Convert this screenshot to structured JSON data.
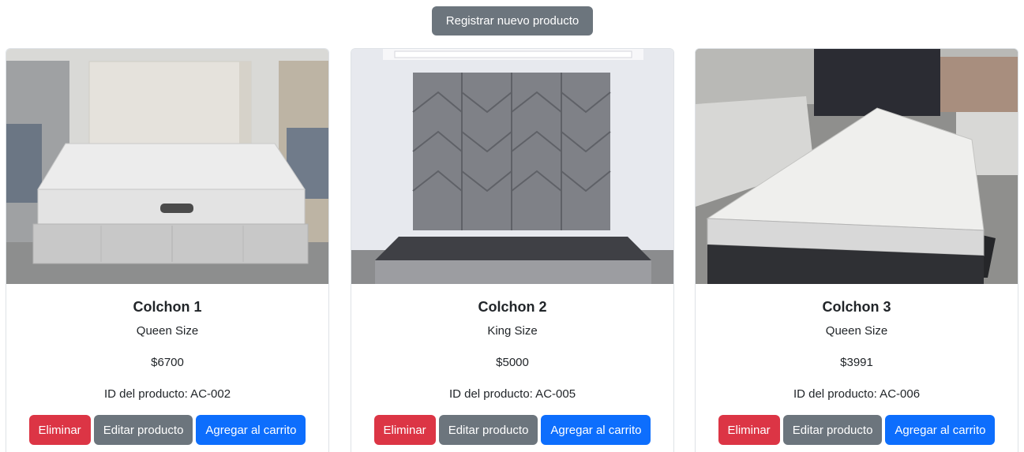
{
  "header": {
    "register_label": "Registrar nuevo producto"
  },
  "colors": {
    "danger": "#dc3545",
    "secondary": "#6c757d",
    "primary": "#0d6efd"
  },
  "products": [
    {
      "title": "Colchon 1",
      "size": "Queen Size",
      "price": "$6700",
      "product_id": "ID del producto: AC-002",
      "image_alt": "Colchon 1",
      "delete_label": "Eliminar",
      "edit_label": "Editar producto",
      "cart_label": "Agregar al carrito"
    },
    {
      "title": "Colchon 2",
      "size": "King Size",
      "price": "$5000",
      "product_id": "ID del producto: AC-005",
      "image_alt": "Colchon 2",
      "delete_label": "Eliminar",
      "edit_label": "Editar producto",
      "cart_label": "Agregar al carrito"
    },
    {
      "title": "Colchon 3",
      "size": "Queen Size",
      "price": "$3991",
      "product_id": "ID del producto: AC-006",
      "image_alt": "Colchon 3",
      "delete_label": "Eliminar",
      "edit_label": "Editar producto",
      "cart_label": "Agregar al carrito"
    }
  ]
}
